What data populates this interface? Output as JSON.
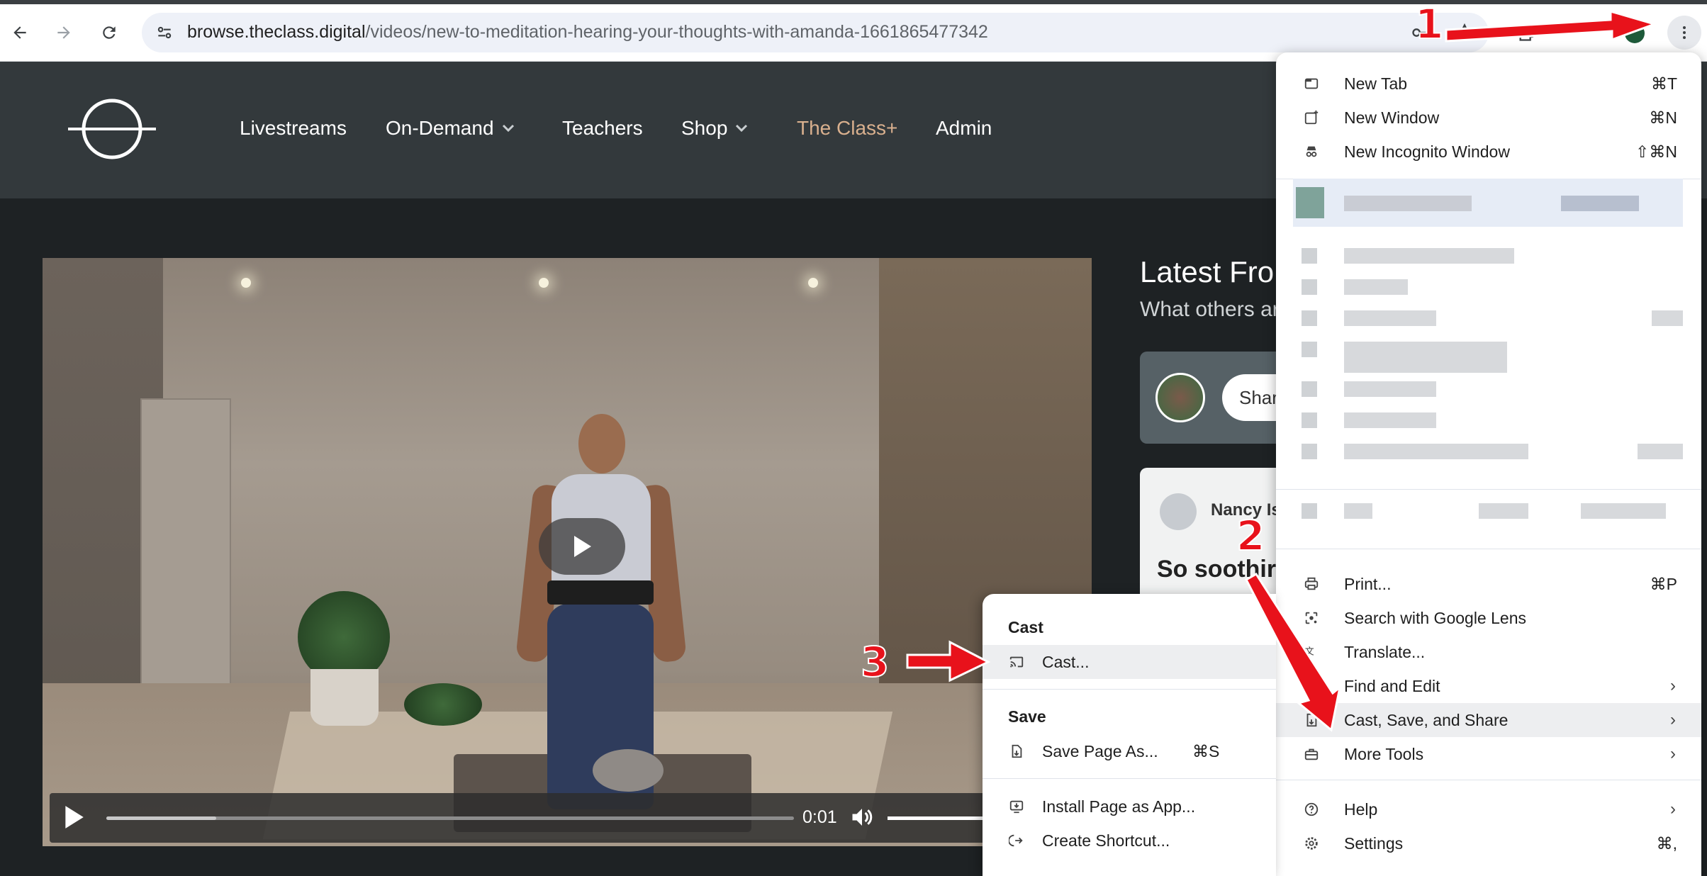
{
  "browser": {
    "url_host": "browse.theclass.digital",
    "url_path": "/videos/new-to-meditation-hearing-your-thoughts-with-amanda-1661865477342"
  },
  "site": {
    "nav": [
      {
        "label": "Livestreams"
      },
      {
        "label": "On-Demand"
      },
      {
        "label": "Teachers"
      },
      {
        "label": "Shop"
      },
      {
        "label": "The Class+"
      },
      {
        "label": "Admin"
      }
    ],
    "accent_color": "#d9b08e"
  },
  "video": {
    "current_time": "0:01",
    "progress_fraction": 0.002,
    "buffered_fraction": 0.16
  },
  "sidebar": {
    "title": "Latest Fro",
    "subtitle": "What others ar",
    "share_label": "Shar",
    "comment_author": "Nancy Is",
    "comment_text": "So soothir"
  },
  "chrome_menu": {
    "items_top": [
      {
        "label": "New Tab",
        "shortcut": "⌘T",
        "icon": "new-tab-icon"
      },
      {
        "label": "New Window",
        "shortcut": "⌘N",
        "icon": "new-window-icon"
      },
      {
        "label": "New Incognito Window",
        "shortcut": "⇧⌘N",
        "icon": "incognito-icon"
      }
    ],
    "items_bottom": [
      {
        "label": "Print...",
        "shortcut": "⌘P",
        "icon": "print-icon"
      },
      {
        "label": "Search with Google Lens",
        "shortcut": "",
        "icon": "lens-icon"
      },
      {
        "label": "Translate...",
        "shortcut": "",
        "icon": "translate-icon"
      },
      {
        "label": "Find and Edit",
        "shortcut": "›",
        "icon": "find-icon"
      },
      {
        "label": "Cast, Save, and Share",
        "shortcut": "›",
        "icon": "cast-save-icon"
      },
      {
        "label": "More Tools",
        "shortcut": "›",
        "icon": "tools-icon"
      }
    ],
    "items_help": [
      {
        "label": "Help",
        "shortcut": "›",
        "icon": "help-icon"
      },
      {
        "label": "Settings",
        "shortcut": "⌘,",
        "icon": "settings-icon"
      }
    ]
  },
  "cast_submenu": {
    "cast_header": "Cast",
    "cast_item": "Cast...",
    "save_header": "Save",
    "save_page": "Save Page As...",
    "save_page_shortcut": "⌘S",
    "install_app": "Install Page as App...",
    "create_shortcut": "Create Shortcut..."
  },
  "annotations": {
    "step1": "1",
    "step2": "2",
    "step3": "3",
    "color": "#e8121b"
  }
}
